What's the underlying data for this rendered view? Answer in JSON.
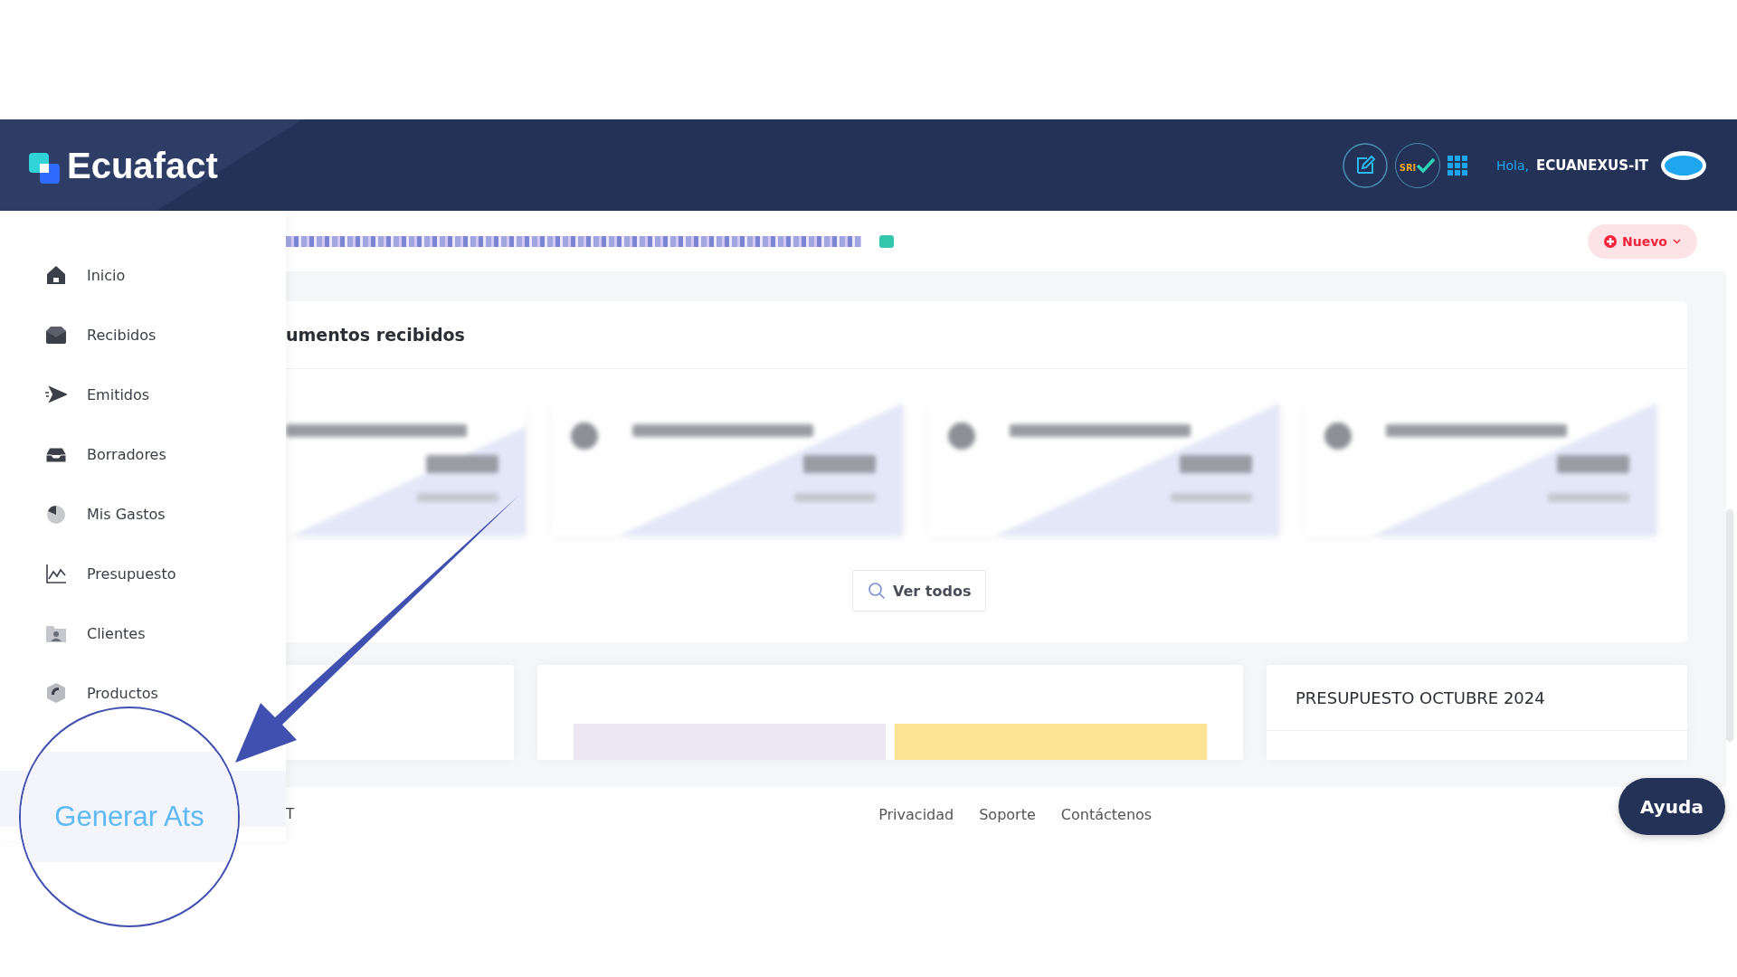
{
  "header": {
    "logo": "Ecuafact",
    "sri_badge": "SRI",
    "greeting": "Hola,",
    "user": "ECUANEXUS-IT"
  },
  "sidebar": {
    "items": [
      {
        "label": "Inicio"
      },
      {
        "label": "Recibidos"
      },
      {
        "label": "Emitidos"
      },
      {
        "label": "Borradores"
      },
      {
        "label": "Mis Gastos"
      },
      {
        "label": "Presupuesto"
      },
      {
        "label": "Clientes"
      },
      {
        "label": "Productos"
      }
    ]
  },
  "new_button": {
    "label": "Nuevo"
  },
  "documents_card": {
    "title": "umentos recibidos",
    "button": "Ver todos"
  },
  "budget_card": {
    "title": "PRESUPUESTO OCTUBRE 2024"
  },
  "footer": {
    "left_text": "T",
    "links": [
      "Privacidad",
      "Soporte",
      "Contáctenos"
    ]
  },
  "help_button": {
    "label": "Ayuda"
  },
  "magnifier": {
    "text": "Generar Ats"
  }
}
